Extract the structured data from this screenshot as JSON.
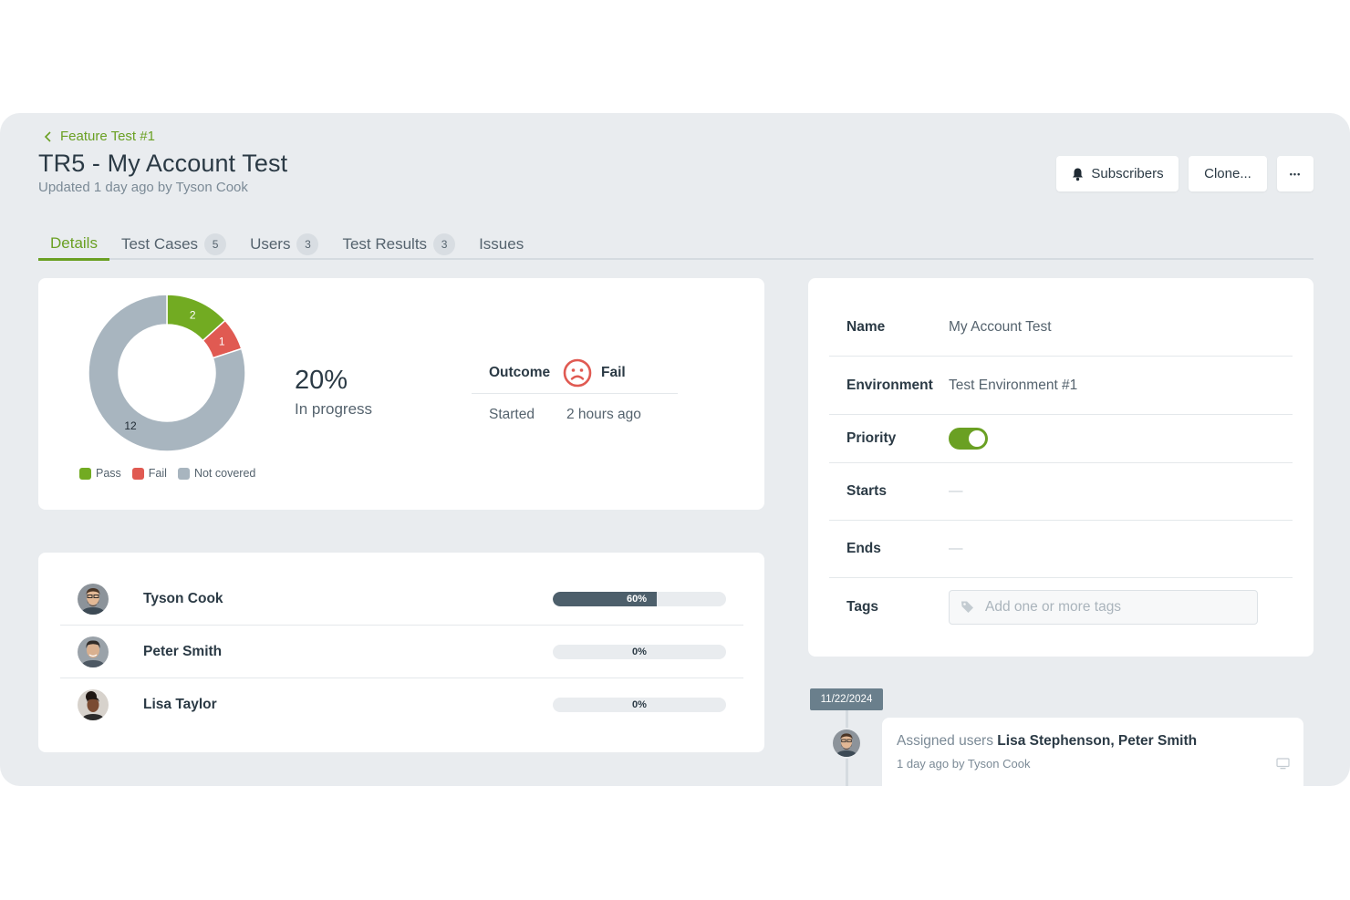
{
  "breadcrumb": {
    "label": "Feature Test #1"
  },
  "header": {
    "title": "TR5 - My Account Test",
    "subtitle": "Updated 1 day ago by Tyson Cook"
  },
  "actions": {
    "subscribers": "Subscribers",
    "clone": "Clone...",
    "more": "•••"
  },
  "tabs": [
    {
      "label": "Details",
      "count": null,
      "active": true
    },
    {
      "label": "Test Cases",
      "count": "5"
    },
    {
      "label": "Users",
      "count": "3"
    },
    {
      "label": "Test Results",
      "count": "3"
    },
    {
      "label": "Issues",
      "count": null
    }
  ],
  "summary": {
    "chart_data": {
      "type": "pie",
      "categories": [
        "Pass",
        "Fail",
        "Not covered"
      ],
      "values": [
        2,
        1,
        12
      ],
      "colors": [
        "#72ab22",
        "#e05a52",
        "#a8b5bf"
      ]
    },
    "legend": [
      "Pass",
      "Fail",
      "Not covered"
    ],
    "progress_value": "20%",
    "progress_label": "In progress",
    "outcome_key": "Outcome",
    "outcome_value": "Fail",
    "started_key": "Started",
    "started_value": "2 hours ago"
  },
  "users": [
    {
      "name": "Tyson Cook",
      "progress": 60,
      "label": "60%"
    },
    {
      "name": "Peter Smith",
      "progress": 0,
      "label": "0%"
    },
    {
      "name": "Lisa Taylor",
      "progress": 0,
      "label": "0%"
    }
  ],
  "info": {
    "name_key": "Name",
    "name_value": "My Account Test",
    "env_key": "Environment",
    "env_value": "Test Environment #1",
    "priority_key": "Priority",
    "priority_on": true,
    "starts_key": "Starts",
    "starts_value": "—",
    "ends_key": "Ends",
    "ends_value": "—",
    "tags_key": "Tags",
    "tags_placeholder": "Add one or more tags"
  },
  "timeline": {
    "date": "11/22/2024",
    "text_prefix": "Assigned users",
    "text_names": "Lisa Stephenson, Peter Smith",
    "meta": "1 day ago by Tyson Cook"
  },
  "colors": {
    "accent": "#6aa023",
    "fail": "#e05a52",
    "bar_fill": "#4d5f6b"
  }
}
